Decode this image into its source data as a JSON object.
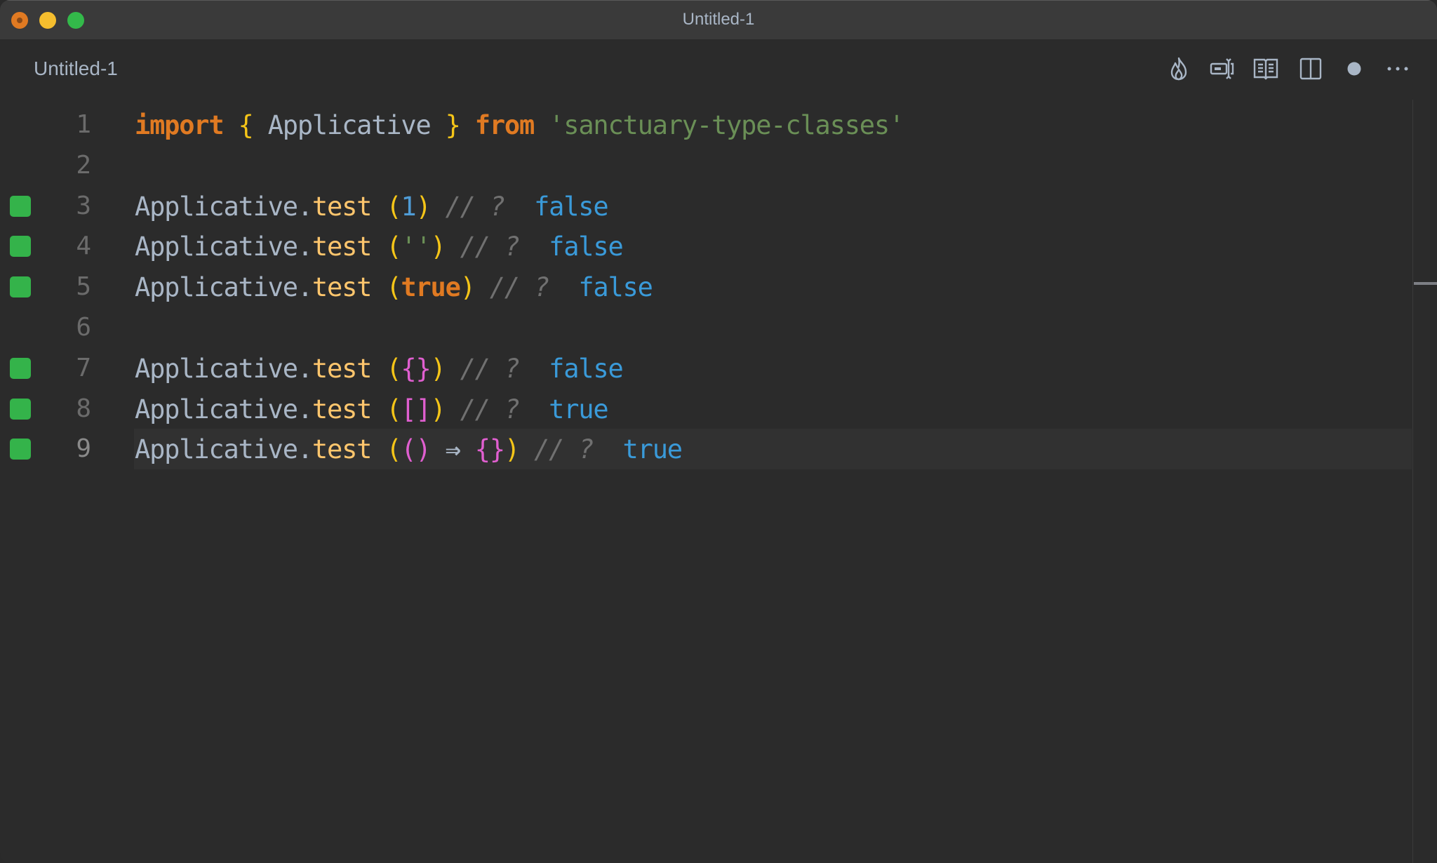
{
  "window": {
    "title": "Untitled-1",
    "controls": [
      "close",
      "minimize",
      "maximize"
    ]
  },
  "tab": {
    "label": "Untitled-1",
    "unsaved": true
  },
  "toolbar": {
    "icons": [
      {
        "name": "flame-icon",
        "label": "Quokka"
      },
      {
        "name": "text-cursor-icon",
        "label": "Toggle"
      },
      {
        "name": "open-preview-icon",
        "label": "Open Preview"
      },
      {
        "name": "split-editor-icon",
        "label": "Split Editor"
      },
      {
        "name": "unsaved-dot-icon",
        "label": "Unsaved changes"
      },
      {
        "name": "more-actions-icon",
        "label": "More Actions"
      }
    ]
  },
  "colors": {
    "keyword": "#e07a22",
    "brace": "#f5c518",
    "identifier": "#a9b6c6",
    "string": "#6a8f56",
    "method": "#ffc66d",
    "number": "#4f9cd6",
    "inner_bracket": "#e05fd0",
    "comment": "#707070",
    "result": "#3a9ad9",
    "gutter_marker": "#34b34a"
  },
  "editor": {
    "current_line": 9,
    "scroll_marker_fraction": 0.23,
    "lines": [
      {
        "number": "1",
        "marker": false,
        "tokens": [
          {
            "t": "import",
            "c": "kw"
          },
          {
            "t": " ",
            "c": "id"
          },
          {
            "t": "{",
            "c": "brace"
          },
          {
            "t": " Applicative ",
            "c": "id"
          },
          {
            "t": "}",
            "c": "brace"
          },
          {
            "t": " ",
            "c": "id"
          },
          {
            "t": "from",
            "c": "kw"
          },
          {
            "t": " ",
            "c": "id"
          },
          {
            "t": "'sanctuary-type-classes'",
            "c": "str"
          }
        ]
      },
      {
        "number": "2",
        "marker": false,
        "tokens": []
      },
      {
        "number": "3",
        "marker": true,
        "tokens": [
          {
            "t": "Applicative.",
            "c": "id"
          },
          {
            "t": "test",
            "c": "method"
          },
          {
            "t": " ",
            "c": "id"
          },
          {
            "t": "(",
            "c": "brace"
          },
          {
            "t": "1",
            "c": "num"
          },
          {
            "t": ")",
            "c": "brace"
          },
          {
            "t": " // ?  ",
            "c": "comment"
          },
          {
            "t": "false",
            "c": "result"
          }
        ]
      },
      {
        "number": "4",
        "marker": true,
        "tokens": [
          {
            "t": "Applicative.",
            "c": "id"
          },
          {
            "t": "test",
            "c": "method"
          },
          {
            "t": " ",
            "c": "id"
          },
          {
            "t": "(",
            "c": "brace"
          },
          {
            "t": "''",
            "c": "str"
          },
          {
            "t": ")",
            "c": "brace"
          },
          {
            "t": " // ?  ",
            "c": "comment"
          },
          {
            "t": "false",
            "c": "result"
          }
        ]
      },
      {
        "number": "5",
        "marker": true,
        "tokens": [
          {
            "t": "Applicative.",
            "c": "id"
          },
          {
            "t": "test",
            "c": "method"
          },
          {
            "t": " ",
            "c": "id"
          },
          {
            "t": "(",
            "c": "brace"
          },
          {
            "t": "true",
            "c": "bool"
          },
          {
            "t": ")",
            "c": "brace"
          },
          {
            "t": " // ?  ",
            "c": "comment"
          },
          {
            "t": "false",
            "c": "result"
          }
        ]
      },
      {
        "number": "6",
        "marker": false,
        "tokens": []
      },
      {
        "number": "7",
        "marker": true,
        "tokens": [
          {
            "t": "Applicative.",
            "c": "id"
          },
          {
            "t": "test",
            "c": "method"
          },
          {
            "t": " ",
            "c": "id"
          },
          {
            "t": "(",
            "c": "brace"
          },
          {
            "t": "{}",
            "c": "inner"
          },
          {
            "t": ")",
            "c": "brace"
          },
          {
            "t": " // ?  ",
            "c": "comment"
          },
          {
            "t": "false",
            "c": "result"
          }
        ]
      },
      {
        "number": "8",
        "marker": true,
        "tokens": [
          {
            "t": "Applicative.",
            "c": "id"
          },
          {
            "t": "test",
            "c": "method"
          },
          {
            "t": " ",
            "c": "id"
          },
          {
            "t": "(",
            "c": "brace"
          },
          {
            "t": "[]",
            "c": "inner"
          },
          {
            "t": ")",
            "c": "brace"
          },
          {
            "t": " // ?  ",
            "c": "comment"
          },
          {
            "t": "true",
            "c": "result"
          }
        ]
      },
      {
        "number": "9",
        "marker": true,
        "tokens": [
          {
            "t": "Applicative.",
            "c": "id"
          },
          {
            "t": "test",
            "c": "method"
          },
          {
            "t": " ",
            "c": "id"
          },
          {
            "t": "(",
            "c": "brace"
          },
          {
            "t": "()",
            "c": "inner"
          },
          {
            "t": " ",
            "c": "id"
          },
          {
            "t": "⇒",
            "c": "arrow"
          },
          {
            "t": " ",
            "c": "id"
          },
          {
            "t": "{}",
            "c": "inner"
          },
          {
            "t": ")",
            "c": "brace"
          },
          {
            "t": " // ?  ",
            "c": "comment"
          },
          {
            "t": "true",
            "c": "result"
          }
        ]
      }
    ]
  }
}
